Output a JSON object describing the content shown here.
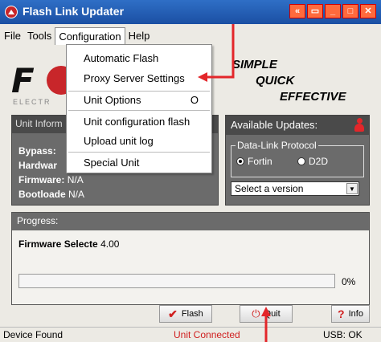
{
  "window": {
    "title": "Flash Link Updater",
    "buttons": [
      "«",
      "▭",
      "_",
      "□",
      "✕"
    ]
  },
  "menu": {
    "items": [
      "File",
      "Tools",
      "Configuration",
      "Help"
    ],
    "active": "Configuration"
  },
  "dropdown": {
    "items": [
      {
        "label": "Automatic Flash"
      },
      {
        "label": "Proxy Server Settings"
      },
      {
        "label": "Unit Options",
        "shortcut": "O"
      },
      {
        "label": "Unit configuration flash"
      },
      {
        "label": "Upload unit log"
      },
      {
        "label": "Special Unit"
      }
    ]
  },
  "logo": {
    "text": "F",
    "subtext": "ELECTR"
  },
  "slogan": [
    "SIMPLE",
    "QUICK",
    "EFFECTIVE"
  ],
  "unit_info": {
    "header": "Unit Inform",
    "rows": [
      {
        "label": "Bypass:",
        "value": ""
      },
      {
        "label": "Hardwar",
        "value": ""
      },
      {
        "label": "Firmware:",
        "value": "N/A"
      },
      {
        "label": "Bootloade",
        "value": "N/A"
      }
    ]
  },
  "updates": {
    "header": "Available Updates:",
    "protocol_legend": "Data-Link Protocol",
    "options": [
      "Fortin",
      "D2D"
    ],
    "selected_option": "Fortin",
    "select_value": "Select a version"
  },
  "progress": {
    "header": "Progress:",
    "firmware_label": "Firmware Selecte",
    "firmware_value": "4.00",
    "percent_text": "0%",
    "percent": 0
  },
  "buttons": {
    "flash": "Flash",
    "quit": "Quit",
    "info": "Info"
  },
  "status": {
    "left": "Device Found",
    "center": "Unit Connected",
    "right": "USB: OK"
  },
  "colors": {
    "accent_red": "#d02020",
    "titlebar_blue": "#1b4fa3",
    "panel_gray": "#6b6b6b"
  }
}
